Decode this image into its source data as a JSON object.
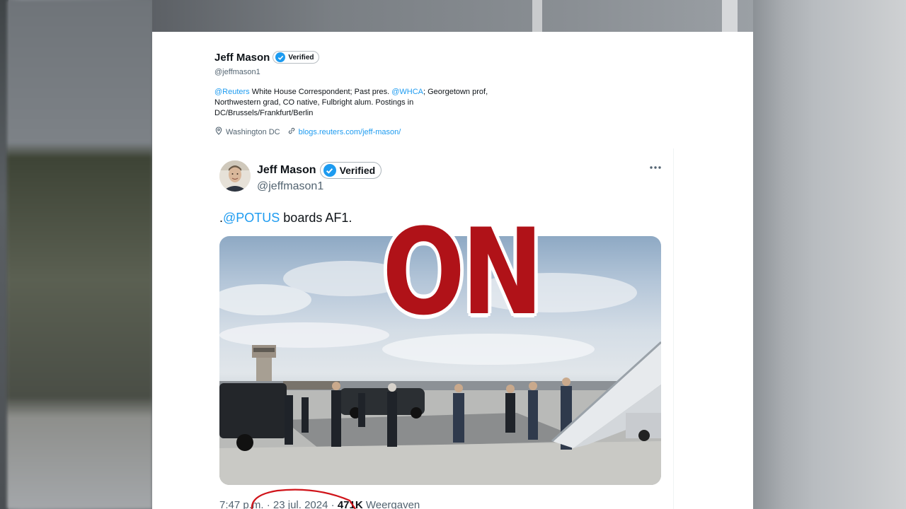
{
  "profile": {
    "name": "Jeff Mason",
    "verified_label": "Verified",
    "handle": "@jeffmason1",
    "bio_mention1": "@Reuters",
    "bio_text1": " White House Correspondent; Past pres. ",
    "bio_mention2": "@WHCA",
    "bio_text2": "; Georgetown prof, Northwestern grad, CO native, Fulbright alum. Postings in DC/Brussels/Frankfurt/Berlin",
    "location": "Washington DC",
    "website": "blogs.reuters.com/jeff-mason/"
  },
  "tweet": {
    "name": "Jeff Mason",
    "verified_label": "Verified",
    "handle": "@jeffmason1",
    "text_prefix": ".",
    "mention": "@POTUS",
    "text_suffix": " boards AF1.",
    "time": "7:47 p.m.",
    "date": "23 jul. 2024",
    "views_count": "471K",
    "views_label": "Weergaven"
  },
  "overlay": {
    "text": "ON",
    "color": "#b01218"
  },
  "icons": {
    "verified": "verified-check-icon",
    "location": "location-pin-icon",
    "link": "link-icon",
    "more": "more-options-icon"
  },
  "colors": {
    "accent": "#1d9bf0",
    "text": "#0f1419",
    "muted": "#536471",
    "annotation": "#d0141a"
  }
}
